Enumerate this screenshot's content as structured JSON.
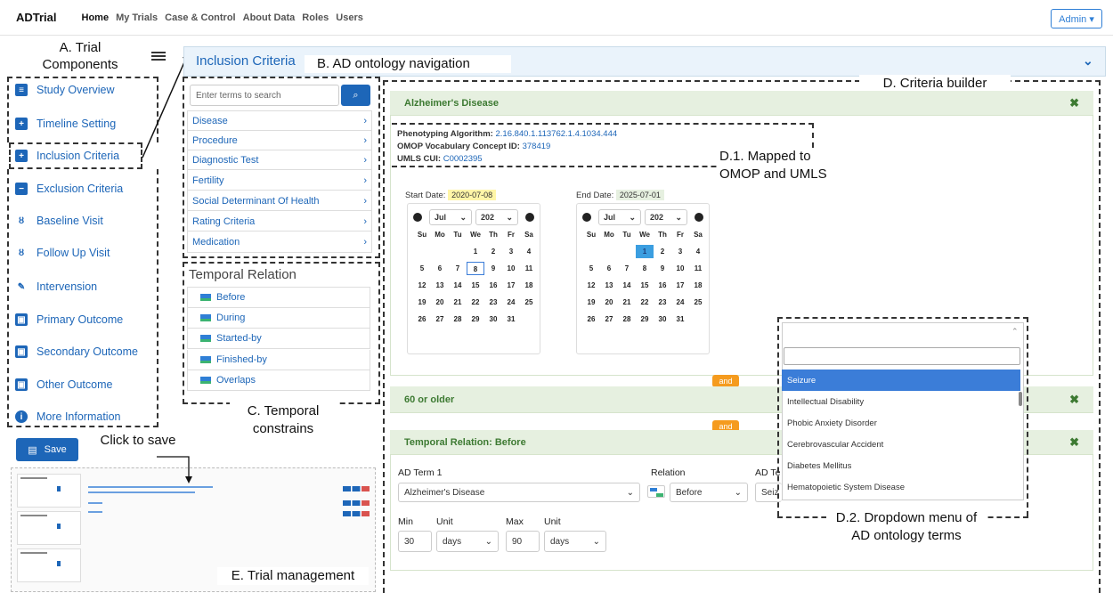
{
  "nav": {
    "brand": "ADTrial",
    "links": [
      "Home",
      "My Trials",
      "Case & Control",
      "About Data",
      "Roles",
      "Users"
    ],
    "admin": "Admin ▾"
  },
  "annotations": {
    "a": "A. Trial Components",
    "b": "B. AD ontology navigation",
    "c": "C. Temporal constrains",
    "d": "D. Criteria builder",
    "d1": "D.1. Mapped to OMOP and UMLS",
    "d2": "D.2. Dropdown menu of AD ontology terms",
    "e": "E. Trial management",
    "save_hint": "Click to save"
  },
  "sidebar": {
    "items": [
      "Study Overview",
      "Timeline Setting",
      "Inclusion Criteria",
      "Exclusion Criteria",
      "Baseline Visit",
      "Follow Up Visit",
      "Intervension",
      "Primary Outcome",
      "Secondary Outcome",
      "Other Outcome",
      "More Information"
    ],
    "save": "Save"
  },
  "panel": {
    "title": "Inclusion Criteria"
  },
  "ontology": {
    "placeholder": "Enter terms to search",
    "categories": [
      "Disease",
      "Procedure",
      "Diagnostic Test",
      "Fertility",
      "Social Determinant Of Health",
      "Rating Criteria",
      "Medication"
    ]
  },
  "temporal": {
    "title": "Temporal Relation",
    "items": [
      "Before",
      "During",
      "Started-by",
      "Finished-by",
      "Overlaps"
    ]
  },
  "criteria": {
    "c1": {
      "title": "Alzheimer's Disease",
      "phen_label": "Phenotyping Algorithm:",
      "phen": "2.16.840.1.113762.1.4.1034.444",
      "omop_label": "OMOP Vocabulary Concept ID:",
      "omop": "378419",
      "umls_label": "UMLS CUI:",
      "umls": "C0002395",
      "start_label": "Start Date:",
      "start": "2020-07-08",
      "end_label": "End Date:",
      "end": "2025-07-01",
      "month": "Jul",
      "year": "202",
      "days_hdr": [
        "Su",
        "Mo",
        "Tu",
        "We",
        "Th",
        "Fr",
        "Sa"
      ]
    },
    "and": "and",
    "c2": {
      "title": "60 or older"
    },
    "c3": {
      "title": "Temporal Relation: Before",
      "term1_label": "AD Term 1",
      "term1": "Alzheimer's Disease",
      "relation_label": "Relation",
      "relation": "Before",
      "term2_label": "AD Te",
      "term2": "Seiz",
      "min_label": "Min",
      "min": "30",
      "unit_label": "Unit",
      "unit": "days",
      "max_label": "Max",
      "max": "90",
      "unit2": "days"
    }
  },
  "dropdown": {
    "options": [
      "Seizure",
      "Intellectual Disability",
      "Phobic Anxiety Disorder",
      "Cerebrovascular Accident",
      "Diabetes Mellitus",
      "Hematopoietic System Disease"
    ]
  },
  "colors": {
    "link": "#1d66b8",
    "accent": "#f59b1e",
    "green_header": "#e6f0e0",
    "selected": "#3b7dd8"
  }
}
